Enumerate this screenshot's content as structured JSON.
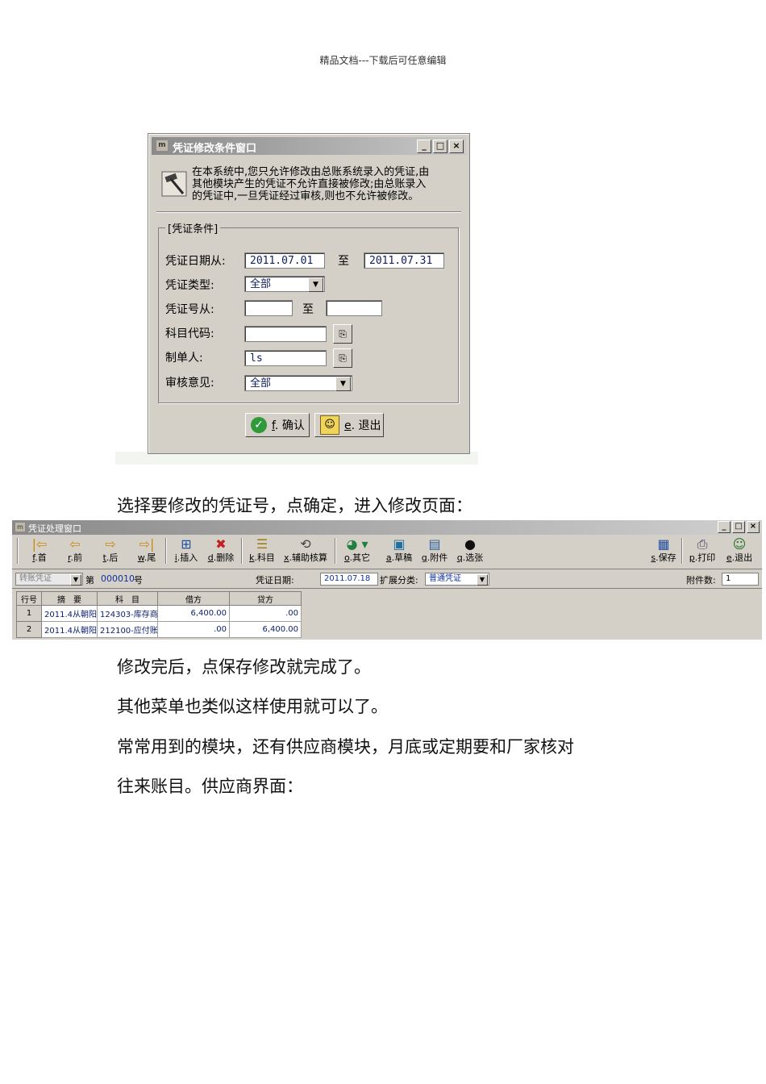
{
  "header": "精品文档---下载后可任意编辑",
  "dialog1": {
    "title": "凭证修改条件窗口",
    "notice_lines": [
      "在本系统中,您只允许修改由总账系统录入的凭证,由",
      "其他模块产生的凭证不允许直接被修改;由总账录入",
      "的凭证中,一旦凭证经过审核,则也不允许被修改。"
    ],
    "group_title": "[凭证条件]",
    "date_from_label": "凭证日期从:",
    "date_from": "2011.07.01",
    "to_label": "至",
    "date_to": "2011.07.31",
    "type_label": "凭证类型:",
    "type_value": "全部",
    "number_label": "凭证号从:",
    "number_to_label": "至",
    "account_label": "科目代码:",
    "maker_label": "制单人:",
    "maker_value": "ls",
    "audit_label": "审核意见:",
    "audit_value": "全部",
    "ok_key": "f",
    "ok_label": "确认",
    "exit_key": "e",
    "exit_label": "退出"
  },
  "text": {
    "p1": "选择要修改的凭证号，点确定，进入修改页面：",
    "p2": "修改完后，点保存修改就完成了。",
    "p3": "其他菜单也类似这样使用就可以了。",
    "p4": "常常用到的模块，还有供应商模块，月底或定期要和厂家核对",
    "p5": "往来账目。供应商界面："
  },
  "window2": {
    "title": "凭证处理窗口",
    "toolbar": [
      {
        "key": "f",
        "label": "首",
        "icon": "first-icon"
      },
      {
        "key": "r",
        "label": "前",
        "icon": "prev-icon"
      },
      {
        "key": "t",
        "label": "后",
        "icon": "next-icon"
      },
      {
        "key": "w",
        "label": "尾",
        "icon": "last-icon"
      },
      {
        "key": "i",
        "label": "插入",
        "icon": "insert-icon"
      },
      {
        "key": "d",
        "label": "删除",
        "icon": "delete-icon"
      },
      {
        "key": "k",
        "label": "科目",
        "icon": "account-icon"
      },
      {
        "key": "x",
        "label": "辅助核算",
        "icon": "auxiliary-icon"
      },
      {
        "key": "o",
        "label": "其它",
        "icon": "other-icon"
      },
      {
        "key": "a",
        "label": "草稿",
        "icon": "draft-icon"
      },
      {
        "key": "g",
        "label": "附件",
        "icon": "attachment-icon"
      },
      {
        "key": "q",
        "label": "选张",
        "icon": "select-icon"
      },
      {
        "key": "s",
        "label": "保存",
        "icon": "save-icon"
      },
      {
        "key": "p",
        "label": "打印",
        "icon": "print-icon"
      },
      {
        "key": "e",
        "label": "退出",
        "icon": "exit-icon"
      }
    ],
    "voucher_type": "转账凭证",
    "no_prefix": "第",
    "voucher_no": "000010",
    "no_suffix": "号",
    "date_label": "凭证日期:",
    "date_value": "2011.07.18",
    "ext_label": "扩展分类:",
    "ext_value": "普通凭证",
    "attach_label": "附件数:",
    "attach_value": "1",
    "columns": [
      "行号",
      "摘　要",
      "科　目",
      "借方",
      "贷方"
    ],
    "rows": [
      [
        "1",
        "2011.4从朝阳",
        "124303-库存商",
        "6,400.00",
        ".00"
      ],
      [
        "2",
        "2011.4从朝阳",
        "212100-应付账",
        ".00",
        "6,400.00"
      ]
    ]
  }
}
